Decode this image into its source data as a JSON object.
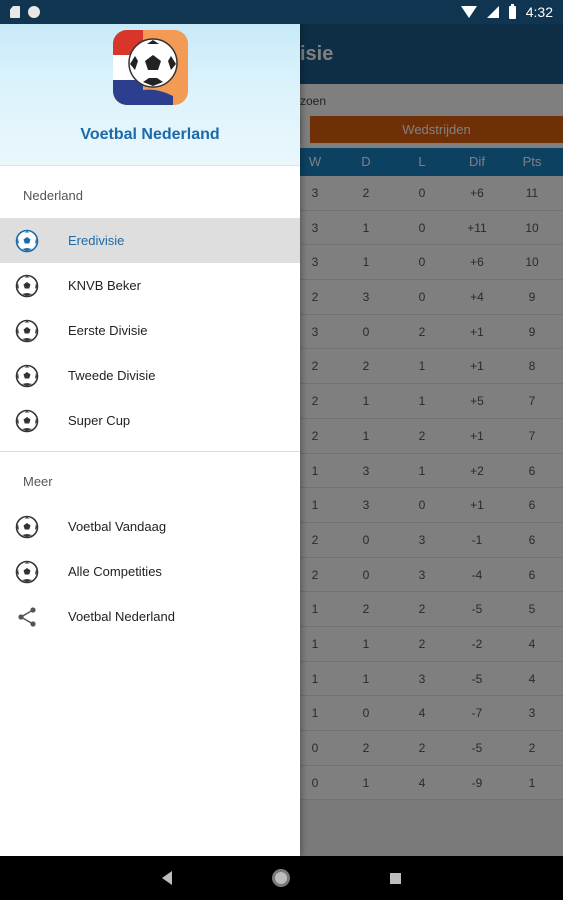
{
  "status_bar": {
    "time": "4:32"
  },
  "background": {
    "toolbar_title": "isie",
    "season_label": "zoen",
    "tab_active": "Wedstrijden",
    "columns": [
      "W",
      "D",
      "L",
      "Dif",
      "Pts"
    ],
    "rows": [
      [
        "3",
        "2",
        "0",
        "+6",
        "11"
      ],
      [
        "3",
        "1",
        "0",
        "+11",
        "10"
      ],
      [
        "3",
        "1",
        "0",
        "+6",
        "10"
      ],
      [
        "2",
        "3",
        "0",
        "+4",
        "9"
      ],
      [
        "3",
        "0",
        "2",
        "+1",
        "9"
      ],
      [
        "2",
        "2",
        "1",
        "+1",
        "8"
      ],
      [
        "2",
        "1",
        "1",
        "+5",
        "7"
      ],
      [
        "2",
        "1",
        "2",
        "+1",
        "7"
      ],
      [
        "1",
        "3",
        "1",
        "+2",
        "6"
      ],
      [
        "1",
        "3",
        "0",
        "+1",
        "6"
      ],
      [
        "2",
        "0",
        "3",
        "-1",
        "6"
      ],
      [
        "2",
        "0",
        "3",
        "-4",
        "6"
      ],
      [
        "1",
        "2",
        "2",
        "-5",
        "5"
      ],
      [
        "1",
        "1",
        "2",
        "-2",
        "4"
      ],
      [
        "1",
        "1",
        "3",
        "-5",
        "4"
      ],
      [
        "1",
        "0",
        "4",
        "-7",
        "3"
      ],
      [
        "0",
        "2",
        "2",
        "-5",
        "2"
      ],
      [
        "0",
        "1",
        "4",
        "-9",
        "1"
      ]
    ]
  },
  "drawer": {
    "app_title": "Voetbal Nederland",
    "section1_label": "Nederland",
    "section1_items": [
      {
        "label": "Eredivisie",
        "icon": "soccer-ball-icon",
        "active": true
      },
      {
        "label": "KNVB Beker",
        "icon": "soccer-ball-icon"
      },
      {
        "label": "Eerste Divisie",
        "icon": "soccer-ball-icon"
      },
      {
        "label": "Tweede Divisie",
        "icon": "soccer-ball-icon"
      },
      {
        "label": "Super Cup",
        "icon": "soccer-ball-icon"
      }
    ],
    "section2_label": "Meer",
    "section2_items": [
      {
        "label": "Voetbal Vandaag",
        "icon": "soccer-ball-icon"
      },
      {
        "label": "Alle Competities",
        "icon": "soccer-ball-icon"
      },
      {
        "label": "Voetbal Nederland",
        "icon": "share-icon"
      }
    ]
  },
  "colors": {
    "accent_blue": "#1c6aa8",
    "toolbar": "#1a5d8a",
    "tab_orange": "#e0610e",
    "header_blue": "#1a82c4"
  }
}
